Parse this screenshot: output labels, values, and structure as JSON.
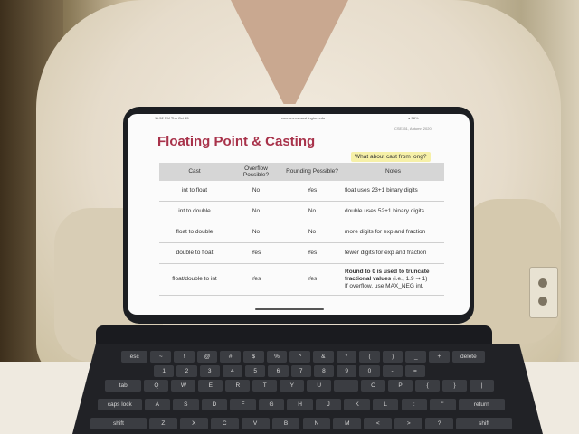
{
  "slide": {
    "status_time": "11:52 PM  Thu Oct 15",
    "status_url": "courses.cs.washington.edu",
    "status_battery": "● 58%",
    "top_right": "CSE351, Autumn 2020",
    "title": "Floating Point & Casting",
    "callout": "What about cast from long?",
    "headers": [
      "Cast",
      "Overflow Possible?",
      "Rounding Possible?",
      "Notes"
    ],
    "rows": [
      {
        "cast": "int to float",
        "overflow": "No",
        "rounding": "Yes",
        "notes": "float uses 23+1 binary digits"
      },
      {
        "cast": "int to double",
        "overflow": "No",
        "rounding": "No",
        "notes": "double uses 52+1 binary digits"
      },
      {
        "cast": "float to double",
        "overflow": "No",
        "rounding": "No",
        "notes": "more digits for exp and fraction"
      },
      {
        "cast": "double to float",
        "overflow": "Yes",
        "rounding": "Yes",
        "notes": "fewer digits for exp and fraction"
      },
      {
        "cast": "float/double to int",
        "overflow": "Yes",
        "rounding": "Yes",
        "notes_bold": "Round to 0 is used to truncate fractional values",
        "notes_example": "(i.e., 1.9 ⇒ 1)",
        "notes_extra": "If overflow, use MAX_NEG int."
      }
    ]
  },
  "keyboard": {
    "row1": [
      "esc",
      "~",
      "!",
      "@",
      "#",
      "$",
      "%",
      "^",
      "&",
      "*",
      "(",
      ")",
      "_",
      "+",
      "delete"
    ],
    "row2": [
      "1",
      "2",
      "3",
      "4",
      "5",
      "6",
      "7",
      "8",
      "9",
      "0",
      "-",
      "="
    ],
    "row3": [
      "tab",
      "Q",
      "W",
      "E",
      "R",
      "T",
      "Y",
      "U",
      "I",
      "O",
      "P",
      "{",
      "}",
      "|"
    ],
    "row4": [
      "caps lock",
      "A",
      "S",
      "D",
      "F",
      "G",
      "H",
      "J",
      "K",
      "L",
      ":",
      "\"",
      "return"
    ],
    "row5": [
      "shift",
      "Z",
      "X",
      "C",
      "V",
      "B",
      "N",
      "M",
      "<",
      ">",
      "?",
      "shift"
    ]
  },
  "colors": {
    "title": "#a8324a",
    "callout_bg": "#f6f0a8",
    "header_bg": "#d6d6d6"
  }
}
